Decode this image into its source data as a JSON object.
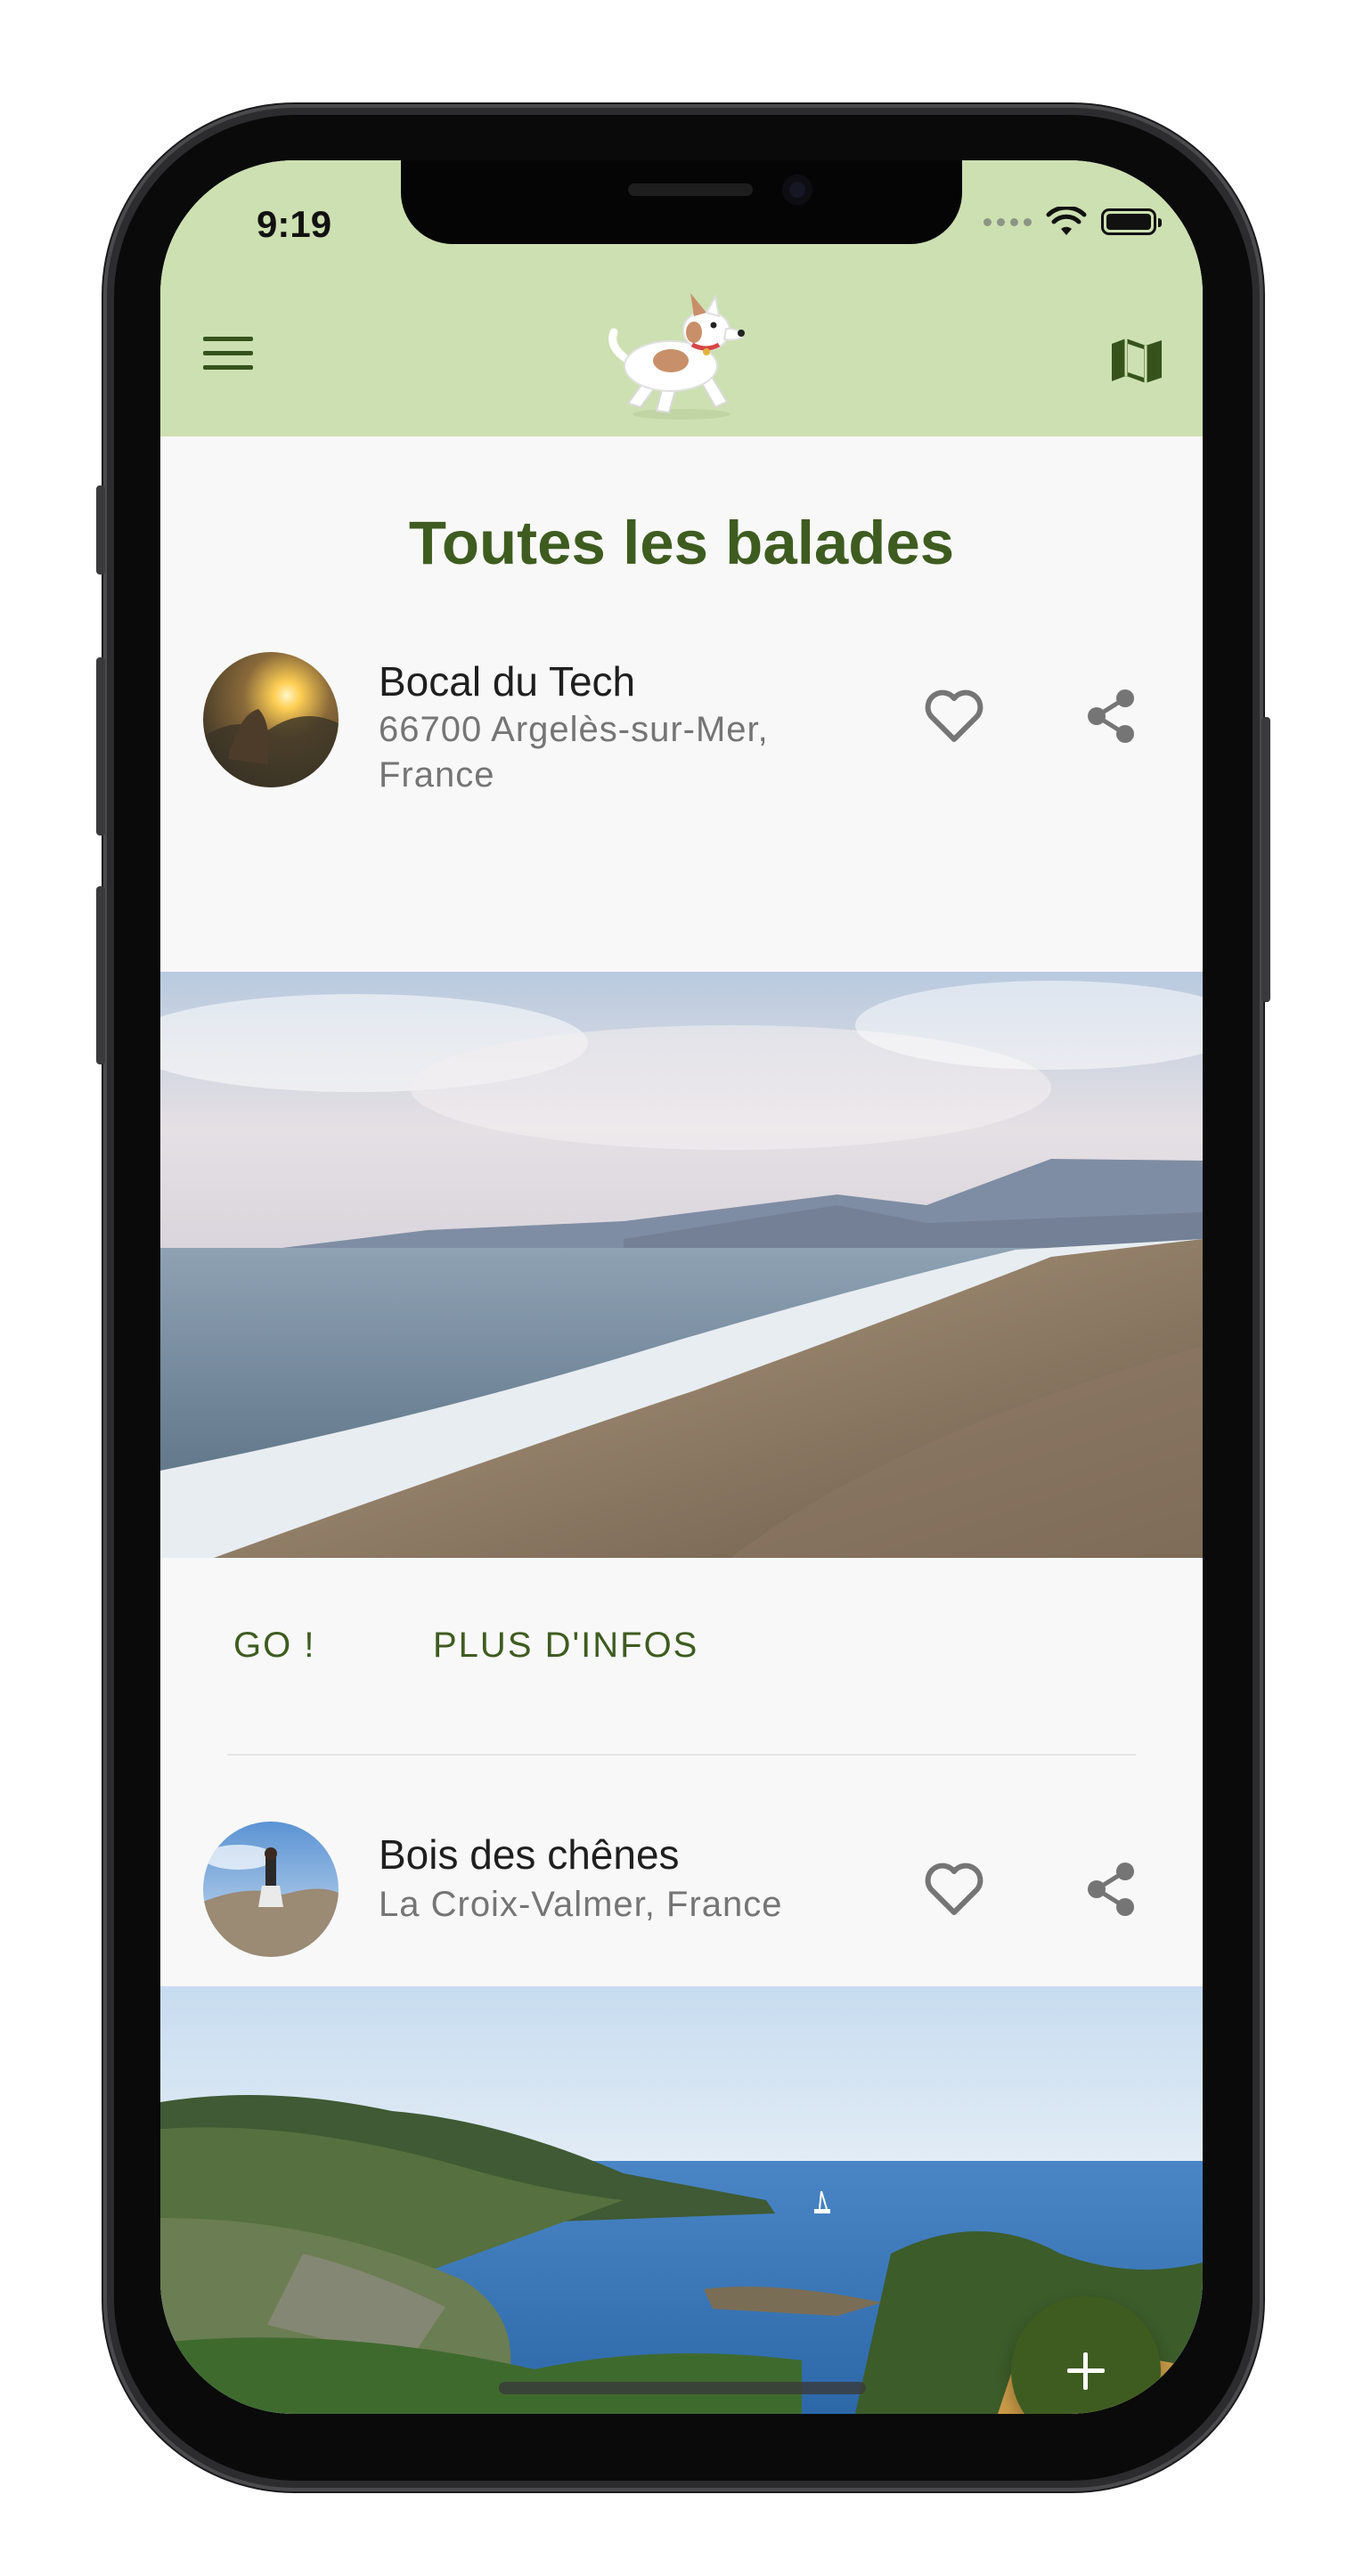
{
  "status_bar": {
    "time": "9:19",
    "wifi_icon": "wifi-icon",
    "battery_icon": "battery-icon"
  },
  "app_bar": {
    "menu_icon": "hamburger-menu-icon",
    "logo": "dog-logo",
    "map_icon": "map-icon",
    "background": "#cde0b1",
    "accent": "#3e5c20"
  },
  "page": {
    "title": "Toutes les balades"
  },
  "walks": [
    {
      "name": "Bocal du Tech",
      "location": "66700 Argelès-sur-Mer, France",
      "favorite_icon": "heart-outline-icon",
      "share_icon": "share-icon",
      "actions": {
        "go": "GO !",
        "more_info": "PLUS D'INFOS"
      }
    },
    {
      "name": "Bois des chênes",
      "location": "La Croix-Valmer, France",
      "favorite_icon": "heart-outline-icon",
      "share_icon": "share-icon"
    }
  ],
  "fab": {
    "icon": "plus-icon"
  }
}
